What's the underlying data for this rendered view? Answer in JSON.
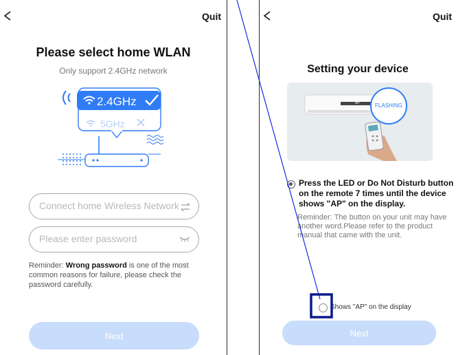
{
  "left": {
    "back_glyph": "<",
    "quit_label": "Quit",
    "title": "Please select home WLAN",
    "subtitle": "Only support 2.4GHz network",
    "wifi_24_label": "2.4GHz",
    "wifi_5_label": "5GHz",
    "ssid_placeholder": "Connect home Wireless Network",
    "password_placeholder": "Please enter password",
    "reminder_prefix": "Reminder: ",
    "reminder_bold": "Wrong password",
    "reminder_rest": " is one of the most common reasons for failure, please check the password carefully.",
    "next_label": "Next"
  },
  "right": {
    "back_glyph": "<",
    "quit_label": "Quit",
    "title": "Setting your device",
    "flashing_label": "FLASHING",
    "ap_label": "AP",
    "option_text": "Press the LED or Do Not Disturb button on the remote 7 times until the device shows \"AP\" on the display.",
    "reminder_text": "Reminder: The button on your unit may have another word.Please refer to the product manual that came with the unit.",
    "confirm_text": "Shows \"AP\" on the display",
    "next_label": "Next"
  },
  "colors": {
    "accent": "#2f7cf6",
    "button_disabled": "#c8dcfb",
    "annotation": "#0b1a8c"
  },
  "icons": {
    "back": "chevron-left-icon",
    "switch": "swap-arrows-icon",
    "password_toggle": "eye-closed-icon",
    "wifi": "wifi-icon",
    "check": "check-icon",
    "cross": "cross-icon"
  }
}
